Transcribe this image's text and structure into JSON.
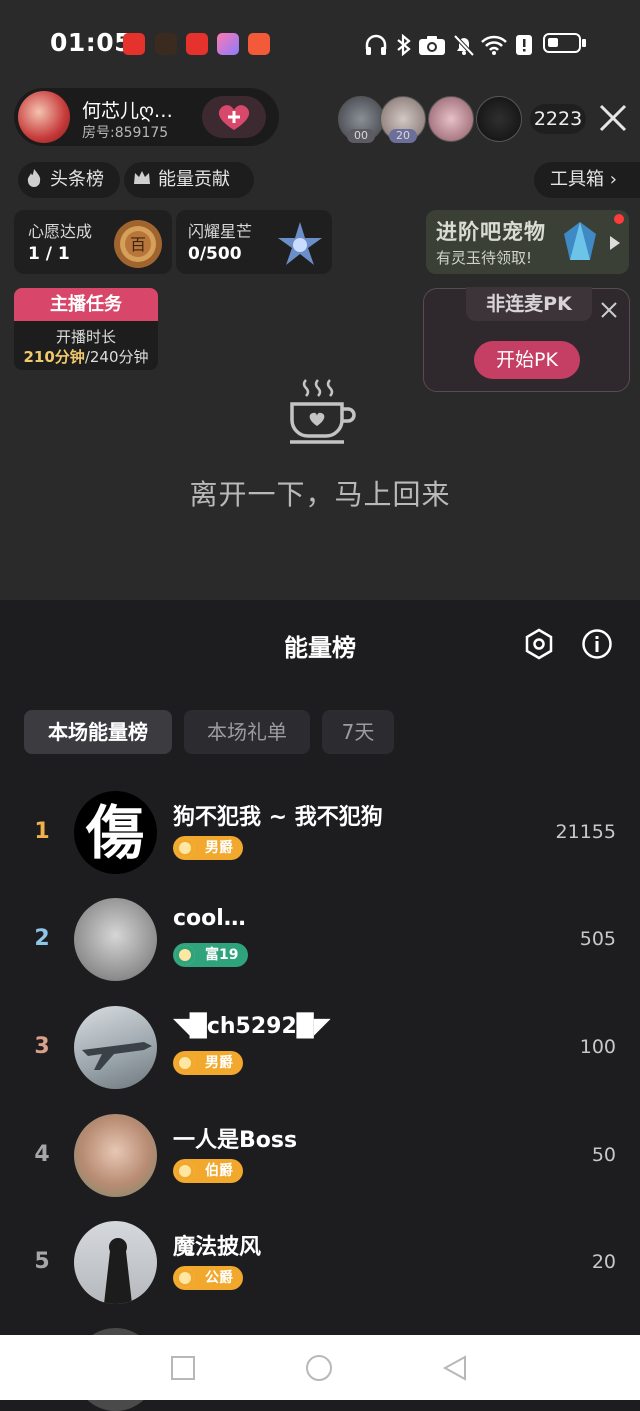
{
  "status": {
    "time": "01:05",
    "app_icons": [
      "huawei-app-icon",
      "game-app-icon",
      "huawei-app-icon-2",
      "gallery-app-icon",
      "clown-app-icon"
    ]
  },
  "host": {
    "name": "何芯儿ღ…",
    "room": "房号:859175"
  },
  "viewers": [
    {
      "badge": "00"
    },
    {
      "badge": "20"
    },
    {
      "badge": ""
    },
    {
      "badge": ""
    }
  ],
  "viewer_count": "2223",
  "pills": {
    "headline": "头条榜",
    "energy": "能量贡献",
    "toolbox": "工具箱 ›"
  },
  "tasks": [
    {
      "title": "心愿达成",
      "value": "1 / 1"
    },
    {
      "title": "闪耀星芒",
      "value": "0/500"
    }
  ],
  "promo": {
    "title": "进阶吧宠物",
    "subtitle": "有灵玉待领取!"
  },
  "host_task": {
    "title": "主播任务",
    "label": "开播时长",
    "progress_done": "210分钟",
    "progress_total": "/240分钟"
  },
  "pk": {
    "tag": "非连麦PK",
    "button": "开始PK"
  },
  "away": {
    "message": "离开一下，马上回来"
  },
  "panel": {
    "title": "能量榜",
    "tabs": [
      "本场能量榜",
      "本场礼单",
      "7天"
    ]
  },
  "ranking": [
    {
      "rank": "1",
      "name": "狗不犯我 ~ 我不犯狗",
      "badge": "男爵",
      "score": "21155",
      "rank_color": "#f0b24a",
      "badge_color": "#f1a82c"
    },
    {
      "rank": "2",
      "name": "cool…",
      "badge": "富19",
      "score": "505",
      "rank_color": "#8fc5e9",
      "badge_color": "#2fa37c"
    },
    {
      "rank": "3",
      "name": "◥█ch5292█◤",
      "badge": "男爵",
      "score": "100",
      "rank_color": "#d9a08a",
      "badge_color": "#f1a82c"
    },
    {
      "rank": "4",
      "name": "一人是Boss",
      "badge": "伯爵",
      "score": "50",
      "rank_color": "#a6a6a6",
      "badge_color": "#f1a82c"
    },
    {
      "rank": "5",
      "name": "魔法披风",
      "badge": "公爵",
      "score": "20",
      "rank_color": "#a6a6a6",
      "badge_color": "#f1a82c"
    }
  ]
}
